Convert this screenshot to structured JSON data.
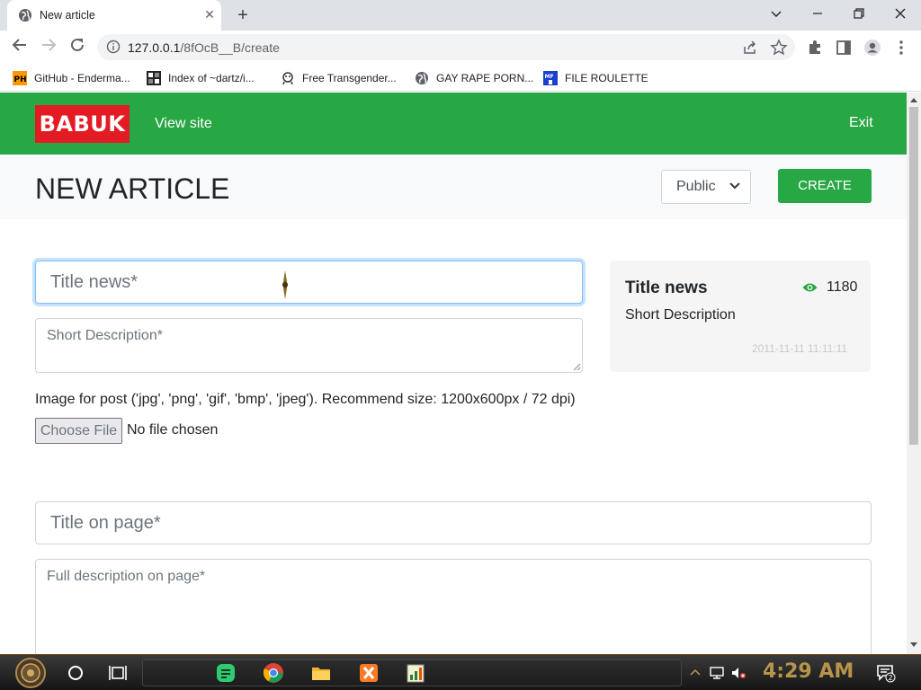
{
  "browser": {
    "tab_title": "New article",
    "url_host": "127.0.0.1",
    "url_path": "/8fOcB__B/create",
    "bookmarks": [
      {
        "label": "GitHub - Enderma...",
        "icon": "ph-icon"
      },
      {
        "label": "Index of ~dartz/i...",
        "icon": "dir-icon"
      },
      {
        "label": "Free Transgender...",
        "icon": "mascot-icon"
      },
      {
        "label": "GAY RAPE PORN...",
        "icon": "globe-icon"
      },
      {
        "label": "FILE ROULETTE",
        "icon": "mf-icon"
      }
    ],
    "colors": {
      "accent": "#28a745",
      "logo": "#e31b23"
    }
  },
  "site": {
    "logo": "BABUK",
    "view_site": "View site",
    "exit": "Exit"
  },
  "header": {
    "title": "NEW ARTICLE",
    "visibility": "Public",
    "create": "CREATE"
  },
  "form": {
    "title_placeholder": "Title news*",
    "short_placeholder": "Short Description*",
    "image_label": "Image for post ('jpg', 'png', 'gif', 'bmp', 'jpeg'). Recommend size: 1200x600px / 72 dpi)",
    "file_button": "Choose File",
    "file_status": "No file chosen",
    "page_title_placeholder": "Title on page*",
    "full_placeholder": "Full description on page*"
  },
  "preview": {
    "title": "Title news",
    "views": "1180",
    "description": "Short Description",
    "date": "2011-11-11 11:11:11"
  },
  "taskbar": {
    "clock": "4:29 AM",
    "notification_count": "2"
  }
}
